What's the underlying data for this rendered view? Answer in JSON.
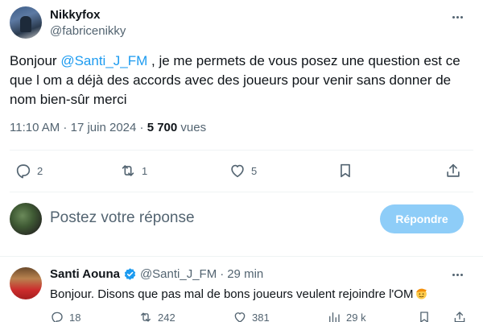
{
  "tweet": {
    "author_name": "Nikkyfox",
    "author_handle": "@fabricenikky",
    "text_before": "Bonjour ",
    "mention": "@Santi_J_FM",
    "text_after": " , je me permets de vous posez une question est ce que l om a déjà des accords avec des joueurs pour venir sans donner de nom bien-sûr merci",
    "time": "11:10 AM",
    "separator": " · ",
    "date": "17 juin 2024",
    "views_count": "5 700",
    "views_label": " vues",
    "actions": {
      "replies": "2",
      "retweets": "1",
      "likes": "5"
    }
  },
  "compose": {
    "placeholder": "Postez votre réponse",
    "button_label": "Répondre"
  },
  "reply": {
    "author_name": "Santi Aouna",
    "author_handle": "@Santi_J_FM",
    "separator": "·",
    "time": "29 min",
    "text": "Bonjour. Disons que pas mal de bons joueurs veulent rejoindre l'OM",
    "actions": {
      "replies": "18",
      "retweets": "242",
      "likes": "381",
      "views": "29 k"
    }
  },
  "colors": {
    "accent": "#1d9bf0",
    "secondary_text": "#536471",
    "reply_button_disabled": "#8ecdf8",
    "divider": "#eff3f4"
  },
  "icons": [
    "more-icon",
    "reply-icon",
    "retweet-icon",
    "like-icon",
    "bookmark-icon",
    "share-icon",
    "verified-badge-icon",
    "views-icon",
    "emoji-icon"
  ]
}
